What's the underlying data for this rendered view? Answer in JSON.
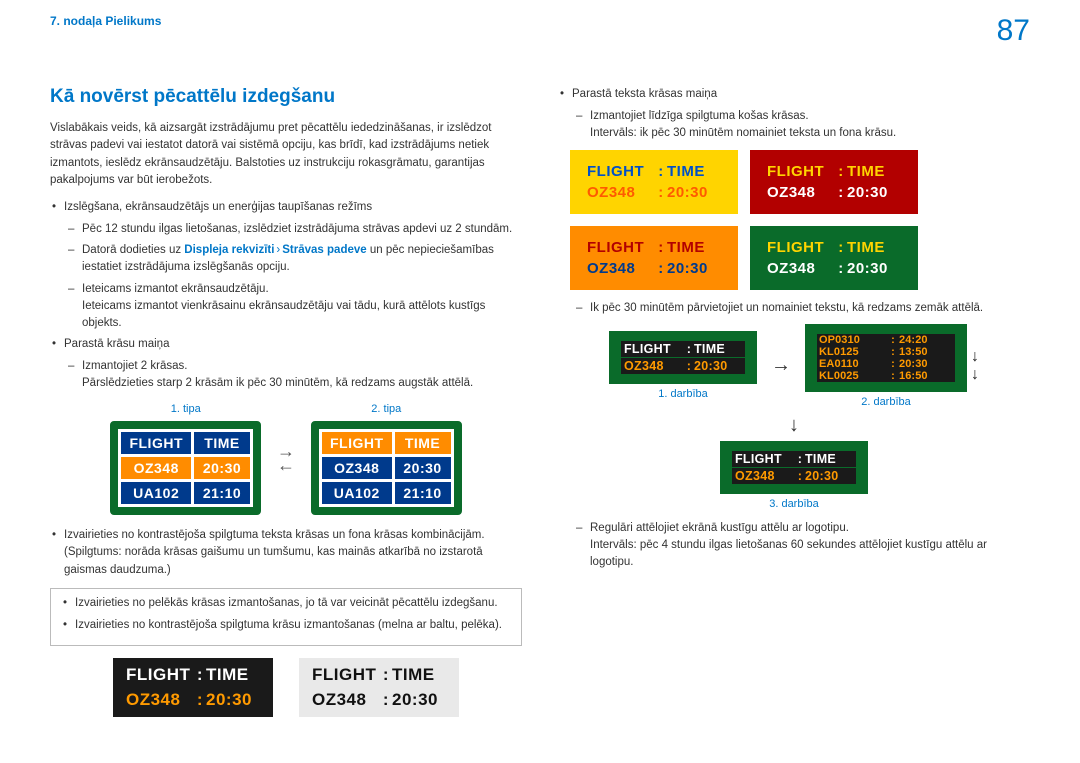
{
  "header": {
    "breadcrumb": "7. nodaļa Pielikums",
    "page": "87"
  },
  "left": {
    "title": "Kā novērst pēcattēlu izdegšanu",
    "intro": "Vislabākais veids, kā aizsargāt izstrādājumu pret pēcattēlu iededzināšanas, ir izslēdzot strāvas padevi vai iestatot datorā vai sistēmā opciju, kas brīdī, kad izstrādājums netiek izmantots, ieslēdz ekrānsaudzētāju. Balstoties uz instrukciju rokasgrāmatu, garantijas pakalpojums var būt ierobežots.",
    "b1": "Izslēgšana, ekrānsaudzētājs un enerģijas taupīšanas režīms",
    "d1a": "Pēc 12 stundu ilgas lietošanas, izslēdziet izstrādājuma strāvas apdevi uz 2 stundām.",
    "d1b_prefix": "Datorā dodieties uz ",
    "kw1": "Displeja rekvizīti",
    "kw_sep": "›",
    "kw2": "Strāvas padeve",
    "d1b_suffix": " un pēc nepieciešamības iestatiet izstrādājuma izslēgšanās opciju.",
    "d1c": "Ieteicams izmantot ekrānsaudzētāju.",
    "d1c2": "Ieteicams izmantot vienkrāsainu ekrānsaudzētāju vai tādu, kurā attēlots kustīgs objekts.",
    "b2": "Parastā krāsu maiņa",
    "d2a": "Izmantojiet 2 krāsas.",
    "d2b": "Pārslēdzieties starp 2 krāsām ik pēc 30 minūtēm, kā redzams augstāk attēlā.",
    "type1": "1. tipa",
    "type2": "2. tipa",
    "F": "FLIGHT",
    "T": "TIME",
    "OZ": "OZ348",
    "t2030": "20:30",
    "UA": "UA102",
    "t2110": "21:10",
    "b3": "Izvairieties no kontrastējoša spilgtuma teksta krāsas un fona krāsas kombinācijām.",
    "b3b": "(Spilgtums: norāda krāsas gaišumu un tumšumu, kas mainās atkarībā no izstarotā gaismas daudzuma.)",
    "note1": "Izvairieties no pelēkās krāsas izmantošanas, jo tā var veicināt pēcattēlu izdegšanu.",
    "note2": "Izvairieties no kontrastējoša spilgtuma krāsu izmantošanas (melna ar baltu, pelēka)."
  },
  "right": {
    "b1": "Parastā teksta krāsas maiņa",
    "d1a": "Izmantojiet līdzīga spilgtuma košas krāsas.",
    "d1b": "Intervāls: ik pēc 30 minūtēm nomainiet teksta un fona krāsu.",
    "d2": "Ik pēc 30 minūtēm pārvietojiet un nomainiet tekstu, kā redzams zemāk attēlā.",
    "step1": "1. darbība",
    "step2": "2. darbība",
    "step3": "3. darbība",
    "OP": "OP0310",
    "t2420": "24:20",
    "KL1": "KL0125",
    "t1350": "13:50",
    "EA": "EA0110",
    "KL2": "KL0025",
    "t1650": "16:50",
    "d3": "Regulāri attēlojiet ekrānā kustīgu attēlu ar logotipu.",
    "d3b": "Intervāls: pēc 4 stundu ilgas lietošanas 60 sekundes attēlojiet kustīgu attēlu ar logotipu."
  }
}
